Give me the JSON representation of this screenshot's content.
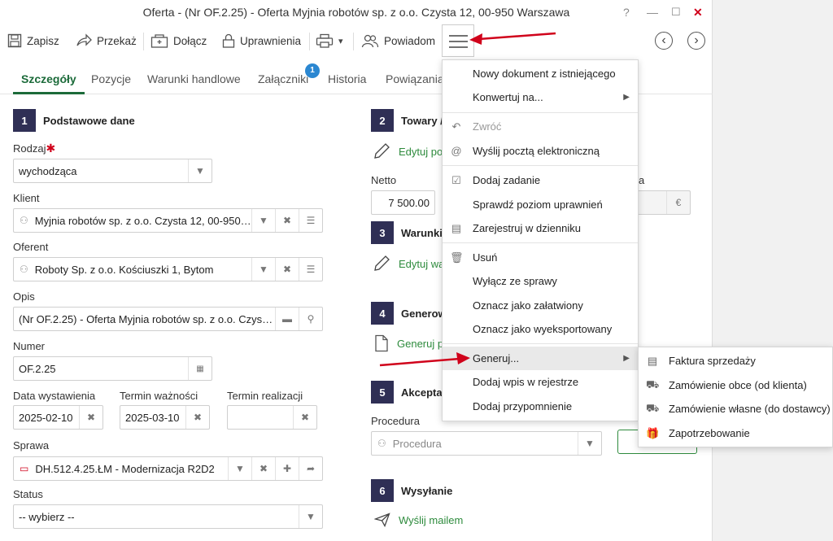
{
  "window": {
    "title": "Oferta - (Nr OF.2.25) - Oferta Myjnia robotów sp. z o.o. Czysta 12, 00-950 Warszawa",
    "help": "?",
    "minimize": "—",
    "maximize": "☐",
    "close": "✕"
  },
  "toolbar": {
    "save": "Zapisz",
    "forward": "Przekaż",
    "attach": "Dołącz",
    "permissions": "Uprawnienia",
    "notify": "Powiadom",
    "print_arrow": "▾",
    "prev": "‹",
    "next": "›"
  },
  "tabs": [
    "Szczegóły",
    "Pozycje",
    "Warunki handlowe",
    "Załączniki",
    "Historia",
    "Powiązania"
  ],
  "attachments_badge": "1",
  "sections": {
    "basic": {
      "num": "1",
      "title": "Podstawowe dane"
    },
    "goods": {
      "num": "2",
      "title": "Towary /"
    },
    "terms": {
      "num": "3",
      "title": "Warunki h"
    },
    "generate": {
      "num": "4",
      "title": "Generow"
    },
    "accept": {
      "num": "5",
      "title": "Akceptac"
    },
    "send": {
      "num": "6",
      "title": "Wysyłanie"
    }
  },
  "form": {
    "type_label": "Rodzaj",
    "required_mark": "✱",
    "type_value": "wychodząca",
    "client_label": "Klient",
    "client_value": "Myjnia robotów sp. z o.o. Czysta 12, 00-950 ...",
    "offerer_label": "Oferent",
    "offerer_value": "Roboty Sp. z o.o. Kościuszki 1, Bytom",
    "desc_label": "Opis",
    "desc_value": "(Nr OF.2.25) - Oferta Myjnia robotów sp. z o.o. Czysta 12",
    "number_label": "Numer",
    "number_value": "OF.2.25",
    "issue_label": "Data wystawienia",
    "issue_value": "2025-02-10",
    "valid_label": "Termin ważności",
    "valid_value": "2025-03-10",
    "realization_label": "Termin realizacji",
    "realization_value": "",
    "case_label": "Sprawa",
    "case_value": "DH.512.4.25.ŁM - Modernizacja R2D2",
    "status_label": "Status",
    "status_value": "-- wybierz --"
  },
  "right": {
    "edit_goods": "Edytuj po",
    "net_label": "Netto",
    "net_value": "7 500.00",
    "currency_partial": "a",
    "currency_symbol": "€",
    "edit_terms": "Edytuj wa",
    "generate_link": "Generuj p",
    "procedure_label": "Procedura",
    "procedure_placeholder": "Procedura",
    "send_link": "Wyślij mailem"
  },
  "menu": {
    "items": [
      {
        "label": "Nowy dokument z istniejącego",
        "icon": "",
        "arrow": false
      },
      {
        "label": "Konwertuj na...",
        "icon": "",
        "arrow": true
      },
      {
        "label": "Zwróć",
        "icon": "undo-icon",
        "arrow": false,
        "disabled": true
      },
      {
        "label": "Wyślij pocztą elektroniczną",
        "icon": "at-icon",
        "arrow": false
      },
      {
        "label": "Dodaj zadanie",
        "icon": "calendar-check-icon",
        "arrow": false
      },
      {
        "label": "Sprawdź poziom uprawnień",
        "icon": "",
        "arrow": false
      },
      {
        "label": "Zarejestruj w dzienniku",
        "icon": "register-icon",
        "arrow": false
      },
      {
        "label": "Usuń",
        "icon": "trash-icon",
        "arrow": false
      },
      {
        "label": "Wyłącz ze sprawy",
        "icon": "",
        "arrow": false
      },
      {
        "label": "Oznacz jako załatwiony",
        "icon": "",
        "arrow": false
      },
      {
        "label": "Oznacz jako wyeksportowany",
        "icon": "",
        "arrow": false
      },
      {
        "label": "Generuj...",
        "icon": "",
        "arrow": true,
        "highlighted": true
      },
      {
        "label": "Dodaj wpis w rejestrze",
        "icon": "",
        "arrow": false
      },
      {
        "label": "Dodaj przypomnienie",
        "icon": "",
        "arrow": false
      }
    ],
    "arrow_glyph": "▶"
  },
  "submenu": {
    "items": [
      {
        "label": "Faktura sprzedaży",
        "icon": "invoice-icon"
      },
      {
        "label": "Zamówienie obce (od klienta)",
        "icon": "cart-icon"
      },
      {
        "label": "Zamówienie własne (do dostawcy)",
        "icon": "cart-icon"
      },
      {
        "label": "Zapotrzebowanie",
        "icon": "gift-icon"
      }
    ]
  },
  "colors": {
    "accent": "#1c6b3a",
    "link_green": "#2e8b3d",
    "section_box": "#2f2f55",
    "badge": "#2b87d1",
    "arrow_red": "#d0021b"
  }
}
